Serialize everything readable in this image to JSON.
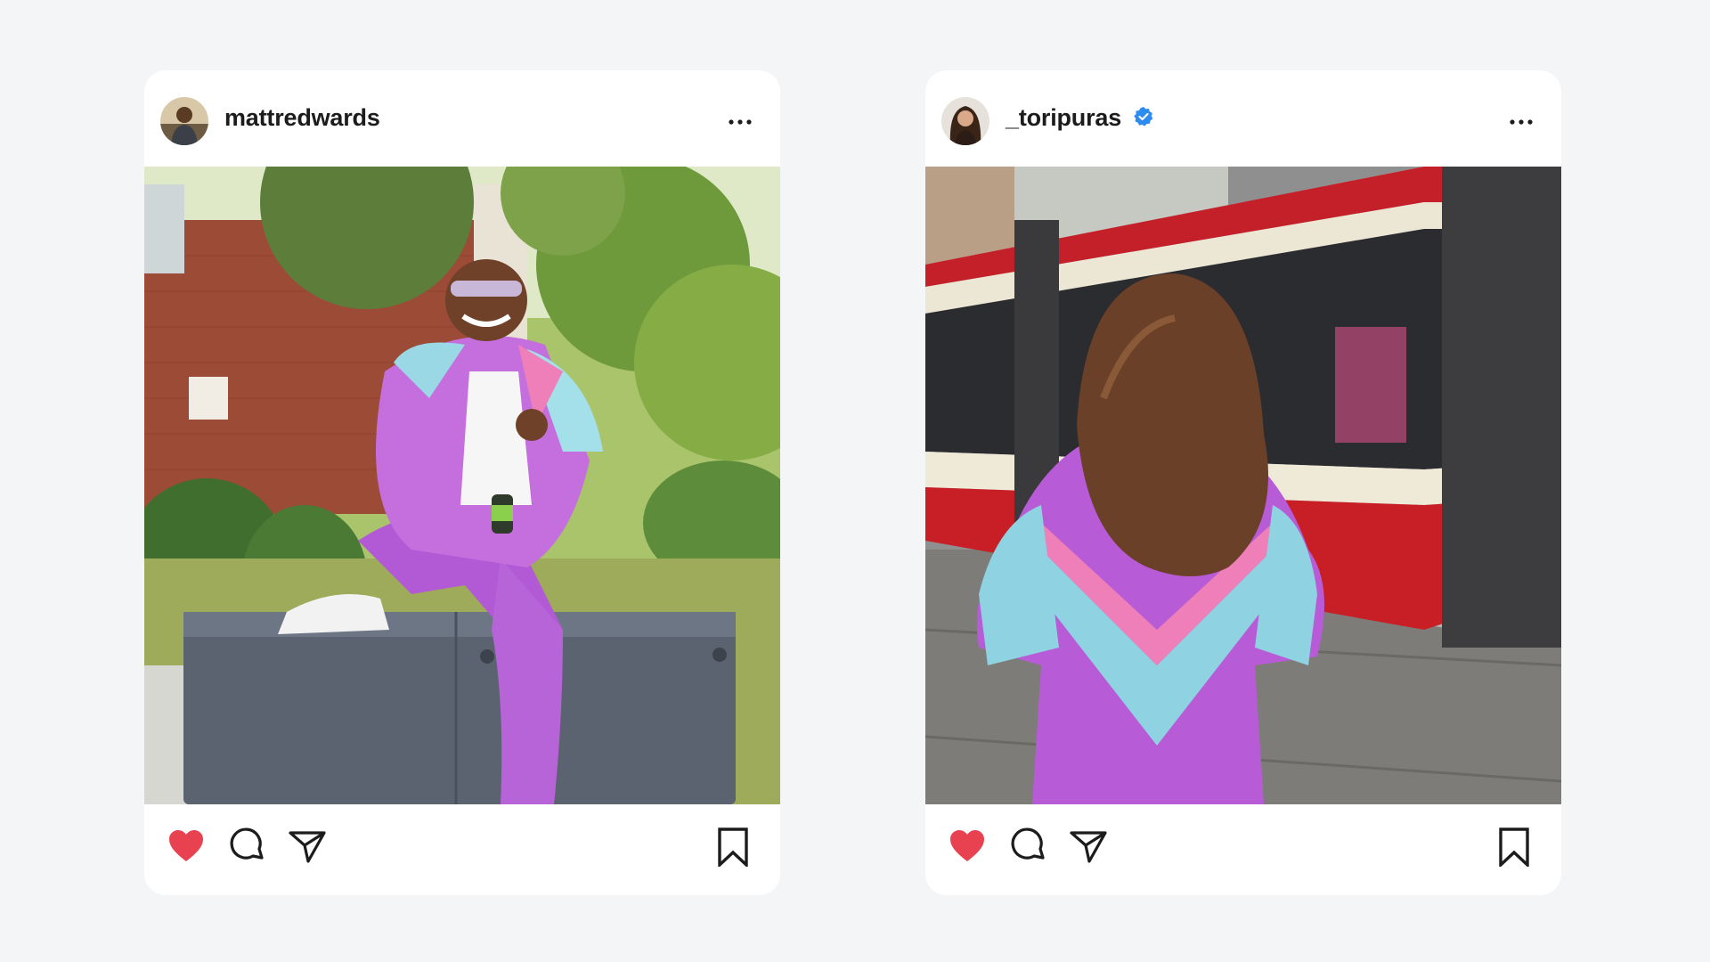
{
  "posts": [
    {
      "username": "mattredwards",
      "verified": false,
      "liked": true,
      "icons": {
        "like": "heart-filled-icon",
        "comment": "comment-bubble-icon",
        "share": "paper-plane-icon",
        "save": "bookmark-icon",
        "more": "more-horizontal-icon"
      }
    },
    {
      "username": "_toripuras",
      "verified": true,
      "liked": true,
      "icons": {
        "like": "heart-filled-icon",
        "comment": "comment-bubble-icon",
        "share": "paper-plane-icon",
        "save": "bookmark-icon",
        "more": "more-horizontal-icon",
        "verified": "verified-badge-icon"
      }
    }
  ],
  "colors": {
    "background": "#f4f5f7",
    "card": "#ffffff",
    "like": "#e8414f",
    "verified": "#2d8cf0",
    "icon": "#1c1c1c"
  }
}
